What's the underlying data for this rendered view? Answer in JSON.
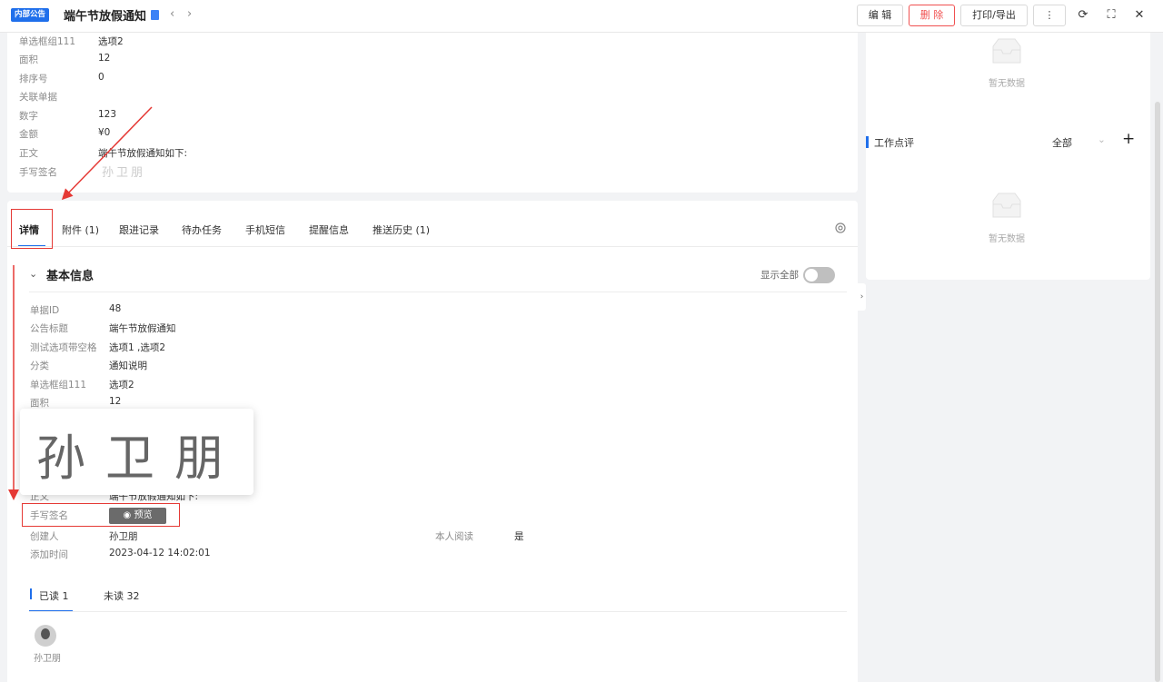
{
  "header": {
    "tag": "内部公告",
    "title": "端午节放假通知",
    "prev": "‹",
    "next": "›",
    "buttons": {
      "edit": "编 辑",
      "delete": "删 除",
      "print": "打印/导出",
      "more": "⋮"
    },
    "icons": {
      "refresh": "⟳",
      "fullscreen": "⛶",
      "close": "✕"
    }
  },
  "top_panel": {
    "fields": [
      {
        "label": "单选框组111",
        "value": "选项2"
      },
      {
        "label": "面积",
        "value": "12"
      },
      {
        "label": "排序号",
        "value": "0"
      },
      {
        "label": "关联单据",
        "value": ""
      },
      {
        "label": "数字",
        "value": "123"
      },
      {
        "label": "金额",
        "value": "¥0"
      },
      {
        "label": "正文",
        "value": "端午节放假通知如下:"
      },
      {
        "label": "手写签名",
        "value": "孙卫朋"
      }
    ]
  },
  "tabs": [
    "详情",
    "附件 (1)",
    "跟进记录",
    "待办任务",
    "手机短信",
    "提醒信息",
    "推送历史 (1)"
  ],
  "section": {
    "title": "基本信息",
    "show_all_label": "显示全部",
    "show_all_on": false
  },
  "fields": [
    {
      "label": "单据ID",
      "value": "48"
    },
    {
      "label": "公告标题",
      "value": "端午节放假通知"
    },
    {
      "label": "测试选项带空格",
      "value": "选项1 ,选项2"
    },
    {
      "label": "分类",
      "value": "通知说明"
    },
    {
      "label": "单选框组111",
      "value": "选项2"
    },
    {
      "label": "面积",
      "value": "12"
    },
    {
      "label": "正文",
      "value": "端午节放假通知如下:"
    },
    {
      "label": "手写签名",
      "value": ""
    },
    {
      "label": "创建人",
      "value": "孙卫朋"
    },
    {
      "label": "添加时间",
      "value": "2023-04-12 14:02:01"
    }
  ],
  "self_read": {
    "label": "本人阅读",
    "value": "是"
  },
  "preview_button": "预览",
  "signature_text": "孙卫朋",
  "read_tabs": {
    "read": "已读 1",
    "unread": "未读 32"
  },
  "reader": {
    "name": "孙卫朋"
  },
  "right_panel": {
    "empty_text": "暂无数据",
    "comment": {
      "title": "工作点评",
      "filter": "全部",
      "add": "+"
    }
  }
}
